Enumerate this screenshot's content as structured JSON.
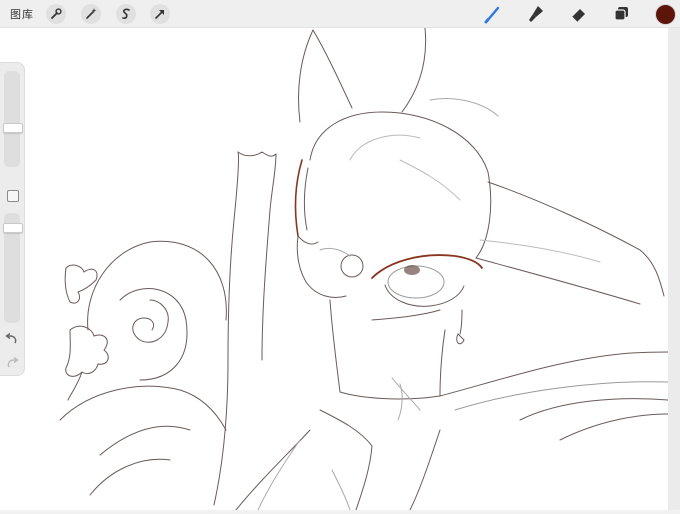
{
  "topbar": {
    "gallery_label": "图库",
    "left_tools": [
      {
        "name": "actions",
        "icon": "wrench-icon"
      },
      {
        "name": "adjustments",
        "icon": "magic-wand-icon"
      },
      {
        "name": "selection",
        "icon": "selection-s-icon"
      },
      {
        "name": "transform",
        "icon": "transform-arrow-icon"
      }
    ],
    "right_tools": [
      {
        "name": "brush",
        "icon": "brush-icon",
        "active": true
      },
      {
        "name": "smudge",
        "icon": "smudge-icon"
      },
      {
        "name": "eraser",
        "icon": "eraser-icon"
      },
      {
        "name": "layers",
        "icon": "layers-icon"
      }
    ],
    "active_color": "#5c1508",
    "active_tool_color": "#2f79e0"
  },
  "sidebar": {
    "brush_size_label": "",
    "opacity_label": "",
    "undo_icon": "undo-arrow-icon",
    "redo_icon": "redo-arrow-icon",
    "modifier_icon": "square-modifier-icon"
  },
  "canvas": {
    "background": "#ffffff",
    "line_color": "#6b5a58",
    "accent_line_color": "#a33a23"
  }
}
